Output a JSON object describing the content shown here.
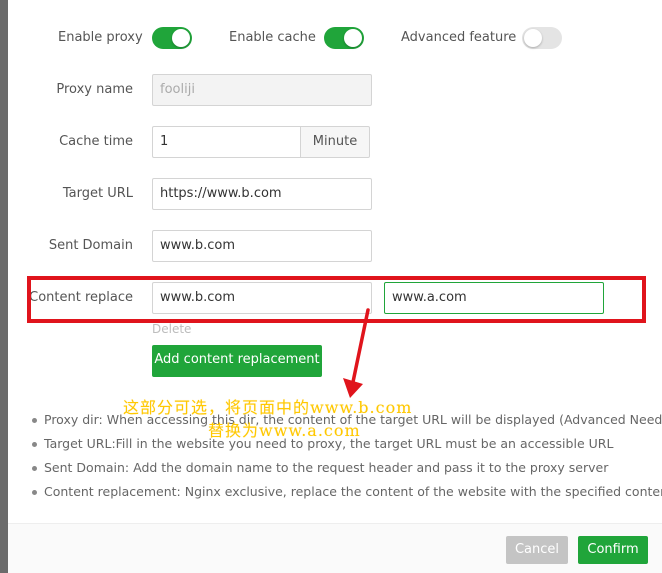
{
  "toggles": [
    {
      "label": "Enable proxy",
      "on": true
    },
    {
      "label": "Enable cache",
      "on": true
    },
    {
      "label": "Advanced feature",
      "on": false
    }
  ],
  "form": {
    "proxy_name": {
      "label": "Proxy name",
      "value": "fooliji"
    },
    "cache_time": {
      "label": "Cache time",
      "value": "1",
      "unit": "Minute"
    },
    "target_url": {
      "label": "Target URL",
      "value": "https://www.b.com"
    },
    "sent_domain": {
      "label": "Sent Domain",
      "value": "www.b.com"
    },
    "content_replace": {
      "label": "Content replace",
      "from": "www.b.com",
      "to": "www.a.com",
      "delete_label": "Delete"
    },
    "add_button": "Add content replacement"
  },
  "annotation": {
    "line1": "这部分可选，将页面中的www.b.com",
    "line2": "替换为www.a.com"
  },
  "tips": [
    "Proxy dir: When accessing this dir, the content of the target URL will be displayed (Advanced Needs)",
    "Target URL:Fill in the website you need to proxy, the target URL must be an accessible URL",
    "Sent Domain: Add the domain name to the request header and pass it to the proxy server",
    "Content replacement: Nginx exclusive, replace the content of the website with the specified content"
  ],
  "footer": {
    "cancel": "Cancel",
    "confirm": "Confirm"
  },
  "colors": {
    "accent": "#20a53a",
    "highlight": "#e0141c",
    "annotation": "#ffc800"
  }
}
